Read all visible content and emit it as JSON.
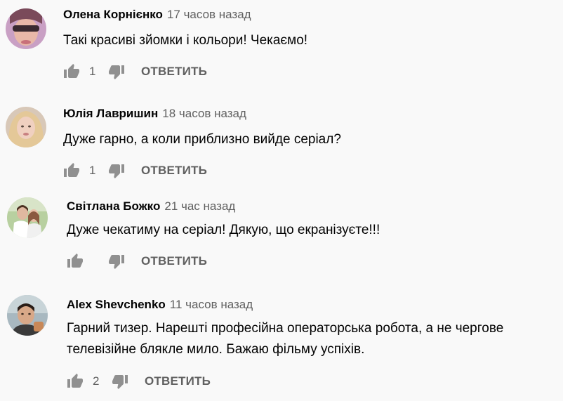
{
  "reply_label": "ОТВЕТИТЬ",
  "comments": [
    {
      "author": "Олена Корнієнко",
      "time": "17 часов назад",
      "text": "Такі красиві зйомки і кольори! Чекаємо!",
      "likes": "1",
      "avatar": "avatar-woman-sunglasses"
    },
    {
      "author": "Юлія Лавришин",
      "time": "18 часов назад",
      "text": "Дуже гарно, а коли приблизно вийде серіал?",
      "likes": "1",
      "avatar": "avatar-woman-blonde"
    },
    {
      "author": "Світлана Божко",
      "time": "21 час назад",
      "text": "Дуже чекатиму на серіал! Дякую, що екранізуєте!!!",
      "likes": "",
      "avatar": "avatar-couple"
    },
    {
      "author": "Alex Shevchenko",
      "time": "11 часов назад",
      "text": "Гарний тизер. Нарешті професійна операторська робота, а не чергове\nтелевізійне блякле мило. Бажаю фільму успіхів.",
      "likes": "2",
      "avatar": "avatar-man"
    }
  ],
  "colors": {
    "background": "#f9f9f9",
    "author": "#030303",
    "secondary": "#606060",
    "icon": "#909090"
  }
}
